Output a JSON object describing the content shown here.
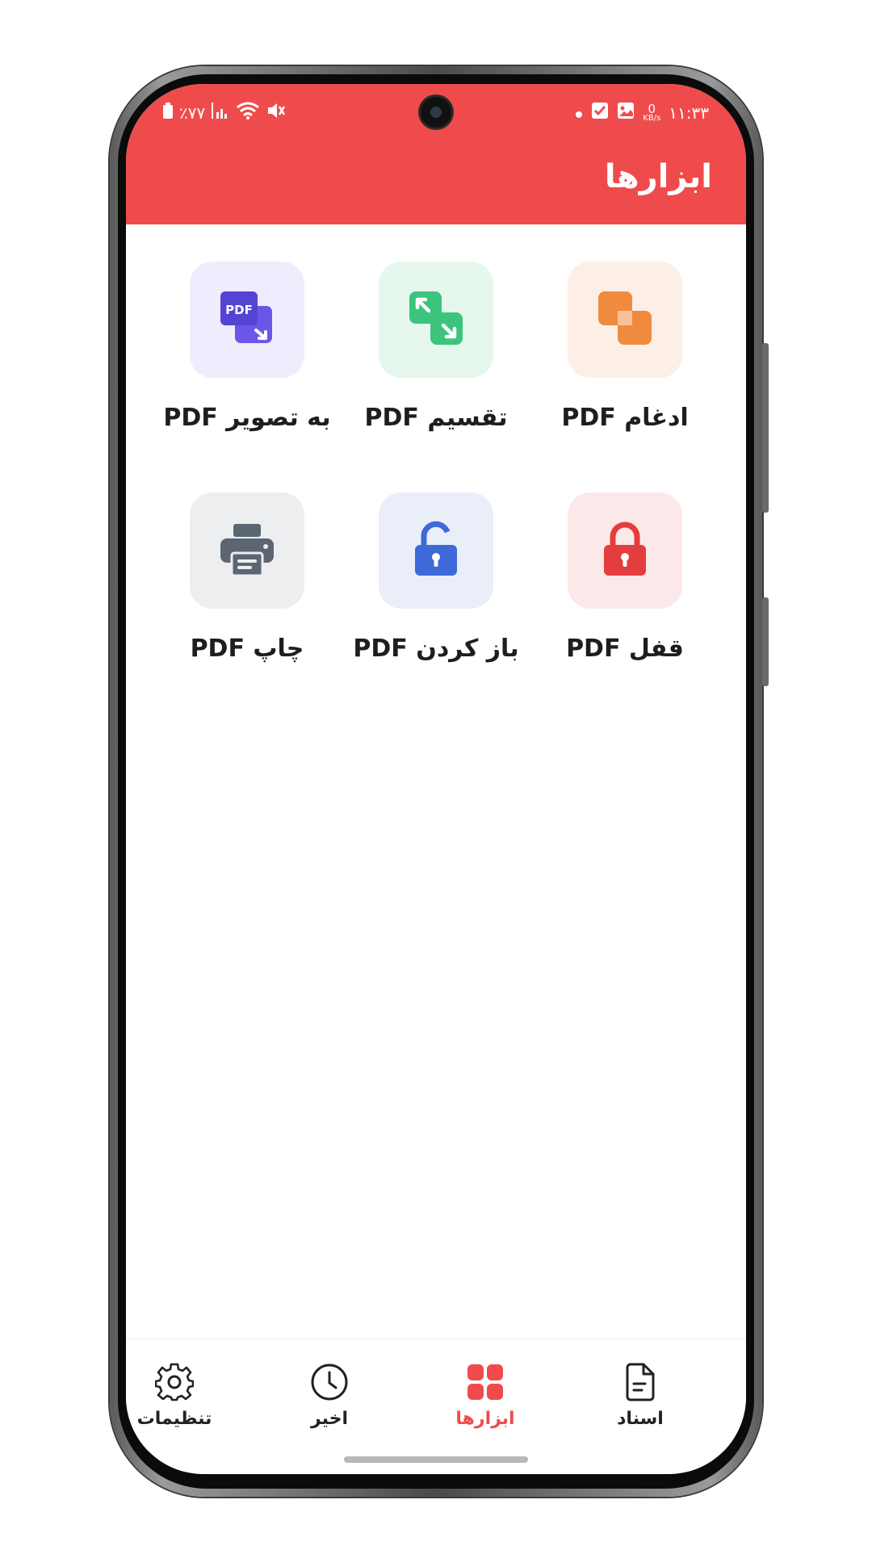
{
  "status_bar": {
    "time": "۱۱:۳۳",
    "net_speed_value": "0",
    "net_speed_unit": "KB/s",
    "battery_percent": "٪۷۷"
  },
  "header": {
    "title": "ابزارها",
    "color": "#f04b4c"
  },
  "tools": [
    {
      "label": "ادغام PDF",
      "icon": "merge-icon",
      "bg": "#fdeee6",
      "color": "#f08a3e"
    },
    {
      "label": "تقسیم PDF",
      "icon": "split-icon",
      "bg": "#e6f7ee",
      "color": "#3cc47c"
    },
    {
      "label": "به تصویر PDF",
      "icon": "pdf-to-image-icon",
      "bg": "#efedfd",
      "color": "#6a57e8"
    },
    {
      "label": "قفل PDF",
      "icon": "lock-icon",
      "bg": "#fbe9e9",
      "color": "#e43d3d"
    },
    {
      "label": "باز کردن PDF",
      "icon": "unlock-icon",
      "bg": "#e9eef9",
      "color": "#3e6ad8"
    },
    {
      "label": "چاپ PDF",
      "icon": "printer-icon",
      "bg": "#eceef0",
      "color": "#5b6672"
    }
  ],
  "pdf_badge": "PDF",
  "bottom_nav": [
    {
      "label": "اسناد",
      "icon": "document-icon",
      "active": false
    },
    {
      "label": "ابزارها",
      "icon": "tools-grid-icon",
      "active": true
    },
    {
      "label": "اخیر",
      "icon": "clock-icon",
      "active": false
    },
    {
      "label": "تنظیمات",
      "icon": "gear-icon",
      "active": false
    }
  ]
}
